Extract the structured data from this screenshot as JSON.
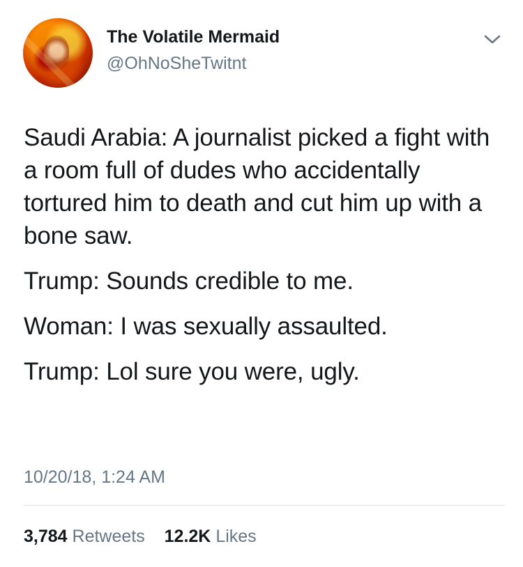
{
  "tweet": {
    "display_name": "The Volatile Mermaid",
    "handle": "@OhNoSheTwitnt",
    "avatar_icon": "profile-avatar-icon",
    "menu_icon": "chevron-down-icon",
    "paragraphs": [
      "Saudi Arabia: A journalist picked a fight with a room full of dudes who accidentally tortured him to death and cut him up with a bone saw.",
      "Trump: Sounds credible to me.",
      "Woman: I was sexually assaulted.",
      "Trump: Lol sure you were, ugly."
    ],
    "timestamp": "10/20/18, 1:24 AM",
    "retweets_count": "3,784",
    "retweets_label": "Retweets",
    "likes_count": "12.2K",
    "likes_label": "Likes"
  },
  "colors": {
    "text": "#14171a",
    "secondary_text": "#657786",
    "divider": "#d8dee2",
    "background": "#ffffff"
  }
}
